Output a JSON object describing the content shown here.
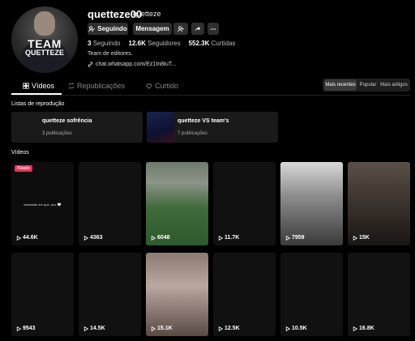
{
  "profile": {
    "username": "quetteze00",
    "nickname": "quetteze",
    "avatar_text_line1": "TEAM",
    "avatar_text_line2": "QUETTEZE",
    "buttons": {
      "following": "Seguindo",
      "message": "Mensagem"
    },
    "stats": [
      {
        "value": "3",
        "label": "Seguindo"
      },
      {
        "value": "12.6K",
        "label": "Seguidores"
      },
      {
        "value": "552.3K",
        "label": "Curtidas"
      }
    ],
    "bio": "Team de editores.",
    "link": "chat.whatsapp.com/Ez1In8tuT..."
  },
  "tabs": [
    {
      "label": "Vídeos",
      "icon": "grid-icon",
      "active": true
    },
    {
      "label": "Republicações",
      "icon": "repost-icon",
      "active": false
    },
    {
      "label": "Curtido",
      "icon": "heart-lock-icon",
      "active": false
    }
  ],
  "sort": {
    "options": [
      "Mais recentes",
      "Popular",
      "Mais antigos"
    ],
    "selected": "Mais recentes"
  },
  "playlists": {
    "heading": "Listas de reprodução",
    "items": [
      {
        "title": "quetteze sofrência",
        "count": "3 publicações"
      },
      {
        "title": "quetteze VS team's",
        "count": "7 publicações"
      }
    ]
  },
  "videos": {
    "heading": "Vídeos",
    "pinned_label": "Fixado",
    "pinned_caption": "obsessão em que, pra, 🤍",
    "items": [
      {
        "views": "44.6K"
      },
      {
        "views": "4363"
      },
      {
        "views": "6048"
      },
      {
        "views": "11.7K"
      },
      {
        "views": "7959"
      },
      {
        "views": "15K"
      },
      {
        "views": "9543"
      },
      {
        "views": "14.5K"
      },
      {
        "views": "15.1K"
      },
      {
        "views": "12.5K"
      },
      {
        "views": "10.5K"
      },
      {
        "views": "16.8K"
      }
    ]
  },
  "colors": {
    "background": "#000000",
    "button": "#2f2f2f",
    "pinned": "#fe2c55"
  }
}
